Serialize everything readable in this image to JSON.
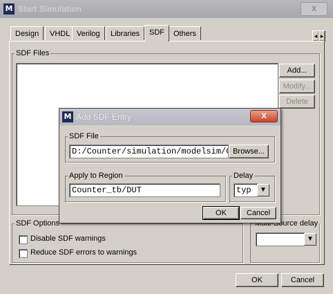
{
  "window": {
    "title": "Start Simulation",
    "close_glyph": "X",
    "icon_label": "M"
  },
  "tabs": [
    {
      "label": "Design"
    },
    {
      "label": "VHDL"
    },
    {
      "label": "Verilog"
    },
    {
      "label": "Libraries"
    },
    {
      "label": "SDF"
    },
    {
      "label": "Others"
    }
  ],
  "tab_scroll": {
    "left": "◂",
    "right": "▸"
  },
  "sdf_files": {
    "label": "SDF Files",
    "add": "Add...",
    "modify": "Modify...",
    "delete": "Delete"
  },
  "sdf_options": {
    "label": "SDF Options",
    "disable_warnings": "Disable SDF warnings",
    "reduce_errors": "Reduce SDF errors to warnings"
  },
  "multi_source": {
    "label": "Multi-Source delay",
    "value": ""
  },
  "footer": {
    "ok": "OK",
    "cancel": "Cancel"
  },
  "dialog": {
    "title": "Add SDF Entry",
    "close_glyph": "X",
    "icon_label": "M",
    "sdf_file_label": "SDF File",
    "sdf_file_value": "D:/Counter/simulation/modelsim/C",
    "browse": "Browse...",
    "region_label": "Apply to Region",
    "region_value": "Counter_tb/DUT",
    "delay_label": "Delay",
    "delay_value": "typ",
    "ok": "OK",
    "cancel": "Cancel"
  }
}
